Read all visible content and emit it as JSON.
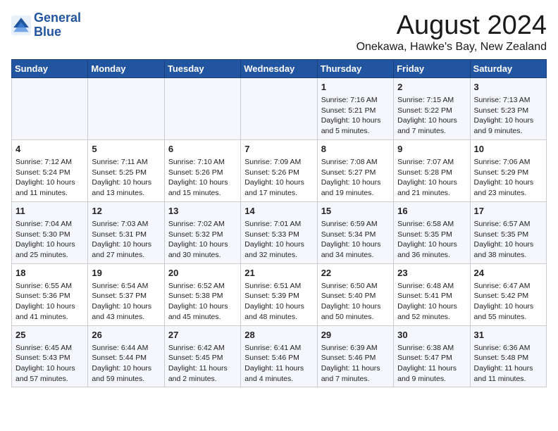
{
  "header": {
    "logo_line1": "General",
    "logo_line2": "Blue",
    "title": "August 2024",
    "subtitle": "Onekawa, Hawke's Bay, New Zealand"
  },
  "weekdays": [
    "Sunday",
    "Monday",
    "Tuesday",
    "Wednesday",
    "Thursday",
    "Friday",
    "Saturday"
  ],
  "weeks": [
    [
      {
        "day": "",
        "info": ""
      },
      {
        "day": "",
        "info": ""
      },
      {
        "day": "",
        "info": ""
      },
      {
        "day": "",
        "info": ""
      },
      {
        "day": "1",
        "info": "Sunrise: 7:16 AM\nSunset: 5:21 PM\nDaylight: 10 hours\nand 5 minutes."
      },
      {
        "day": "2",
        "info": "Sunrise: 7:15 AM\nSunset: 5:22 PM\nDaylight: 10 hours\nand 7 minutes."
      },
      {
        "day": "3",
        "info": "Sunrise: 7:13 AM\nSunset: 5:23 PM\nDaylight: 10 hours\nand 9 minutes."
      }
    ],
    [
      {
        "day": "4",
        "info": "Sunrise: 7:12 AM\nSunset: 5:24 PM\nDaylight: 10 hours\nand 11 minutes."
      },
      {
        "day": "5",
        "info": "Sunrise: 7:11 AM\nSunset: 5:25 PM\nDaylight: 10 hours\nand 13 minutes."
      },
      {
        "day": "6",
        "info": "Sunrise: 7:10 AM\nSunset: 5:26 PM\nDaylight: 10 hours\nand 15 minutes."
      },
      {
        "day": "7",
        "info": "Sunrise: 7:09 AM\nSunset: 5:26 PM\nDaylight: 10 hours\nand 17 minutes."
      },
      {
        "day": "8",
        "info": "Sunrise: 7:08 AM\nSunset: 5:27 PM\nDaylight: 10 hours\nand 19 minutes."
      },
      {
        "day": "9",
        "info": "Sunrise: 7:07 AM\nSunset: 5:28 PM\nDaylight: 10 hours\nand 21 minutes."
      },
      {
        "day": "10",
        "info": "Sunrise: 7:06 AM\nSunset: 5:29 PM\nDaylight: 10 hours\nand 23 minutes."
      }
    ],
    [
      {
        "day": "11",
        "info": "Sunrise: 7:04 AM\nSunset: 5:30 PM\nDaylight: 10 hours\nand 25 minutes."
      },
      {
        "day": "12",
        "info": "Sunrise: 7:03 AM\nSunset: 5:31 PM\nDaylight: 10 hours\nand 27 minutes."
      },
      {
        "day": "13",
        "info": "Sunrise: 7:02 AM\nSunset: 5:32 PM\nDaylight: 10 hours\nand 30 minutes."
      },
      {
        "day": "14",
        "info": "Sunrise: 7:01 AM\nSunset: 5:33 PM\nDaylight: 10 hours\nand 32 minutes."
      },
      {
        "day": "15",
        "info": "Sunrise: 6:59 AM\nSunset: 5:34 PM\nDaylight: 10 hours\nand 34 minutes."
      },
      {
        "day": "16",
        "info": "Sunrise: 6:58 AM\nSunset: 5:35 PM\nDaylight: 10 hours\nand 36 minutes."
      },
      {
        "day": "17",
        "info": "Sunrise: 6:57 AM\nSunset: 5:35 PM\nDaylight: 10 hours\nand 38 minutes."
      }
    ],
    [
      {
        "day": "18",
        "info": "Sunrise: 6:55 AM\nSunset: 5:36 PM\nDaylight: 10 hours\nand 41 minutes."
      },
      {
        "day": "19",
        "info": "Sunrise: 6:54 AM\nSunset: 5:37 PM\nDaylight: 10 hours\nand 43 minutes."
      },
      {
        "day": "20",
        "info": "Sunrise: 6:52 AM\nSunset: 5:38 PM\nDaylight: 10 hours\nand 45 minutes."
      },
      {
        "day": "21",
        "info": "Sunrise: 6:51 AM\nSunset: 5:39 PM\nDaylight: 10 hours\nand 48 minutes."
      },
      {
        "day": "22",
        "info": "Sunrise: 6:50 AM\nSunset: 5:40 PM\nDaylight: 10 hours\nand 50 minutes."
      },
      {
        "day": "23",
        "info": "Sunrise: 6:48 AM\nSunset: 5:41 PM\nDaylight: 10 hours\nand 52 minutes."
      },
      {
        "day": "24",
        "info": "Sunrise: 6:47 AM\nSunset: 5:42 PM\nDaylight: 10 hours\nand 55 minutes."
      }
    ],
    [
      {
        "day": "25",
        "info": "Sunrise: 6:45 AM\nSunset: 5:43 PM\nDaylight: 10 hours\nand 57 minutes."
      },
      {
        "day": "26",
        "info": "Sunrise: 6:44 AM\nSunset: 5:44 PM\nDaylight: 10 hours\nand 59 minutes."
      },
      {
        "day": "27",
        "info": "Sunrise: 6:42 AM\nSunset: 5:45 PM\nDaylight: 11 hours\nand 2 minutes."
      },
      {
        "day": "28",
        "info": "Sunrise: 6:41 AM\nSunset: 5:46 PM\nDaylight: 11 hours\nand 4 minutes."
      },
      {
        "day": "29",
        "info": "Sunrise: 6:39 AM\nSunset: 5:46 PM\nDaylight: 11 hours\nand 7 minutes."
      },
      {
        "day": "30",
        "info": "Sunrise: 6:38 AM\nSunset: 5:47 PM\nDaylight: 11 hours\nand 9 minutes."
      },
      {
        "day": "31",
        "info": "Sunrise: 6:36 AM\nSunset: 5:48 PM\nDaylight: 11 hours\nand 11 minutes."
      }
    ]
  ]
}
